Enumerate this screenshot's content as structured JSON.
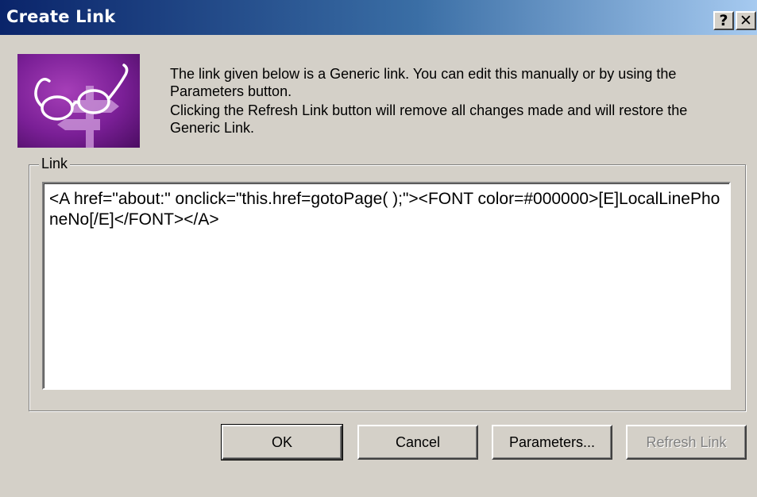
{
  "window": {
    "title": "Create Link",
    "help_label": "?",
    "close_label": "✕"
  },
  "message": {
    "line1": "The link given below is a Generic link. You can edit this manually or by using the Parameters button.",
    "line2": "Clicking the Refresh Link button will remove all changes made and will restore the Generic Link."
  },
  "link_group": {
    "label": "Link",
    "value": "<A href=\"about:\" onclick=\"this.href=gotoPage( );\"><FONT color=#000000>[E]LocalLinePhoneNo[/E]</FONT></A>"
  },
  "buttons": {
    "ok": "OK",
    "cancel": "Cancel",
    "parameters": "Parameters...",
    "refresh": "Refresh Link"
  },
  "icons": {
    "app_icon": "glasses-signpost-icon"
  },
  "colors": {
    "titlebar_start": "#0a246a",
    "titlebar_end": "#a6caf0",
    "dialog_bg": "#d4d0c8",
    "icon_bg": "#7a1f96"
  }
}
